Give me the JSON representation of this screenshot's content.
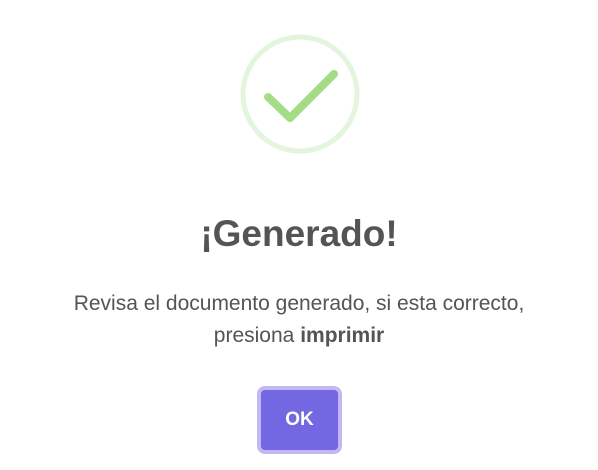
{
  "dialog": {
    "icon": "success-check-icon",
    "title": "¡Generado!",
    "message_part1": "Revisa el documento generado, si esta correcto,",
    "message_part2": "presiona",
    "message_emphasis": "imprimir",
    "confirm_label": "OK"
  },
  "colors": {
    "success_ring": "#e3f5dc",
    "success_check": "#a5dc86",
    "title_text": "#545454",
    "button_bg": "#7367e2",
    "button_focus_ring": "#c3b8f3"
  }
}
